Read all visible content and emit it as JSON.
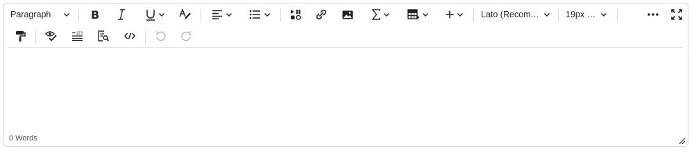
{
  "toolbar": {
    "block_format": {
      "label": "Paragraph",
      "icon": "chevron-down-icon"
    },
    "bold": {
      "icon": "bold-icon"
    },
    "italic": {
      "icon": "italic-icon"
    },
    "underline": {
      "icon": "underline-icon"
    },
    "text_color": {
      "icon": "text-color-icon"
    },
    "align": {
      "icon": "align-left-icon"
    },
    "list": {
      "icon": "bulleted-list-icon"
    },
    "media": {
      "icon": "insert-stuff-icon"
    },
    "link": {
      "icon": "link-icon"
    },
    "image": {
      "icon": "image-icon"
    },
    "equation": {
      "icon": "sigma-icon"
    },
    "table": {
      "icon": "table-icon"
    },
    "insert": {
      "icon": "plus-icon"
    },
    "font_family": {
      "label": "Lato (Recom…"
    },
    "font_size": {
      "label": "19px …"
    },
    "more": {
      "icon": "more-icon"
    },
    "fullscreen": {
      "icon": "fullscreen-icon"
    },
    "format_painter": {
      "icon": "format-painter-icon"
    },
    "accessibility": {
      "icon": "accessibility-checker-icon"
    },
    "line_height": {
      "icon": "line-height-icon"
    },
    "preview": {
      "icon": "preview-icon"
    },
    "source_code": {
      "icon": "source-code-icon"
    },
    "undo": {
      "icon": "undo-icon"
    },
    "redo": {
      "icon": "redo-icon"
    }
  },
  "status": {
    "word_count": "0 Words"
  },
  "colors": {
    "border": "#cdd5dc",
    "icon": "#202122",
    "disabled": "#b7bcc2"
  }
}
